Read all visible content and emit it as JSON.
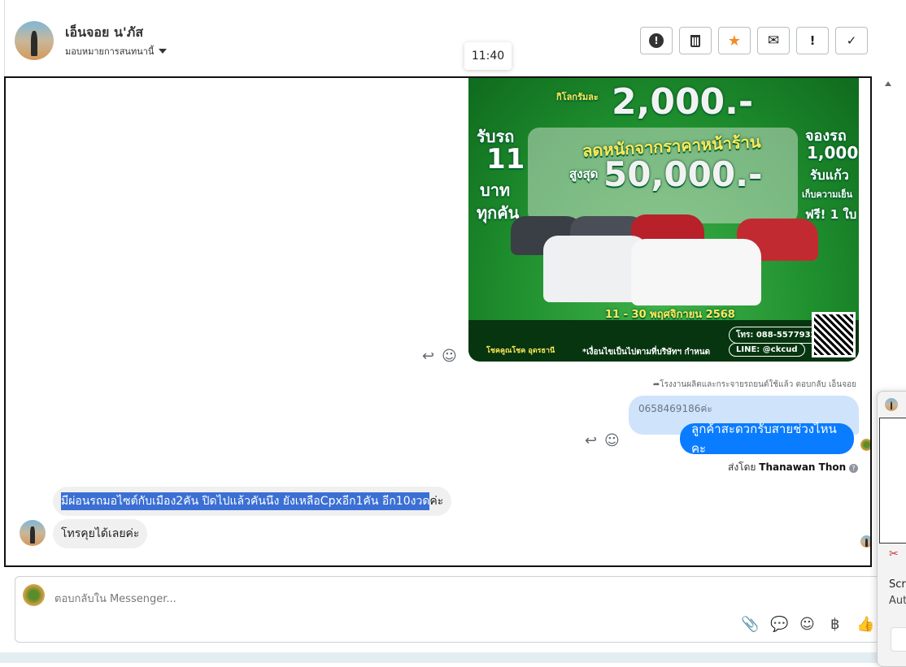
{
  "header": {
    "contact_name": "เอ็นจอย น'ภัส",
    "assign_label": "มอบหมายการสนทนานี้",
    "actions": [
      {
        "name": "spam-button",
        "icon": "exclamation-circle-icon",
        "glyph": "❗"
      },
      {
        "name": "delete-button",
        "icon": "trash-icon",
        "glyph": "🗑"
      },
      {
        "name": "star-button",
        "icon": "star-icon",
        "glyph": "★"
      },
      {
        "name": "mark-unread-button",
        "icon": "envelope-open-icon",
        "glyph": "✉"
      },
      {
        "name": "follow-up-button",
        "icon": "exclamation-icon",
        "glyph": "!"
      },
      {
        "name": "done-button",
        "icon": "check-icon",
        "glyph": "✓"
      }
    ],
    "star_color": "#f28c28"
  },
  "tooltip": {
    "time": "11:40"
  },
  "ad": {
    "price_prefix": "กิโลกรัมละ",
    "price": "2,000.-",
    "left_promo": [
      "รับรถ",
      "11",
      "บาท",
      "ทุกคัน"
    ],
    "discount_headline": "ลดหนักจากราคาหน้าร้าน",
    "max_prefix": "สูงสุด",
    "max_discount": "50,000.-",
    "right_promo": [
      "จองรถ",
      "1,000",
      "รับแก้ว",
      "เก็บความเย็น",
      "ฟรี! 1 ใบ"
    ],
    "dates": "11 - 30 พฤศจิกายน 2568",
    "phone": "โทร: 088-5577932",
    "line": "LINE: @ckcud",
    "terms": "*เงื่อนไขเป็นไปตามที่บริษัทฯ กำหนด",
    "brand": "โชคคูณโชค อุดรธานี"
  },
  "messages": {
    "reply_context": "โรงงานผลิตและกระจายรถยนต์ใช้แล้ว ตอบกลับ เอ็นจอย",
    "quoted": "0658469186ค่ะ",
    "outgoing": "ลูกค้าสะดวกรับสายช่วงไหนคะ",
    "sent_by_prefix": "ส่งโดย",
    "sent_by_name": "Thanawan Thon",
    "incoming_1_selected": "มีผ่อนรถมอไซต์กับเมือง2คัน ปิดไปแล้วคันนึง ยังเหลือCpxอีก1คัน อีก10งวด",
    "incoming_1_rest": "ค่ะ",
    "incoming_2": "โทรคุยได้เลยค่ะ"
  },
  "compose": {
    "placeholder": "ตอบกลับใน Messenger..."
  },
  "popup": {
    "line1": "Scr",
    "line2": "Aut"
  }
}
